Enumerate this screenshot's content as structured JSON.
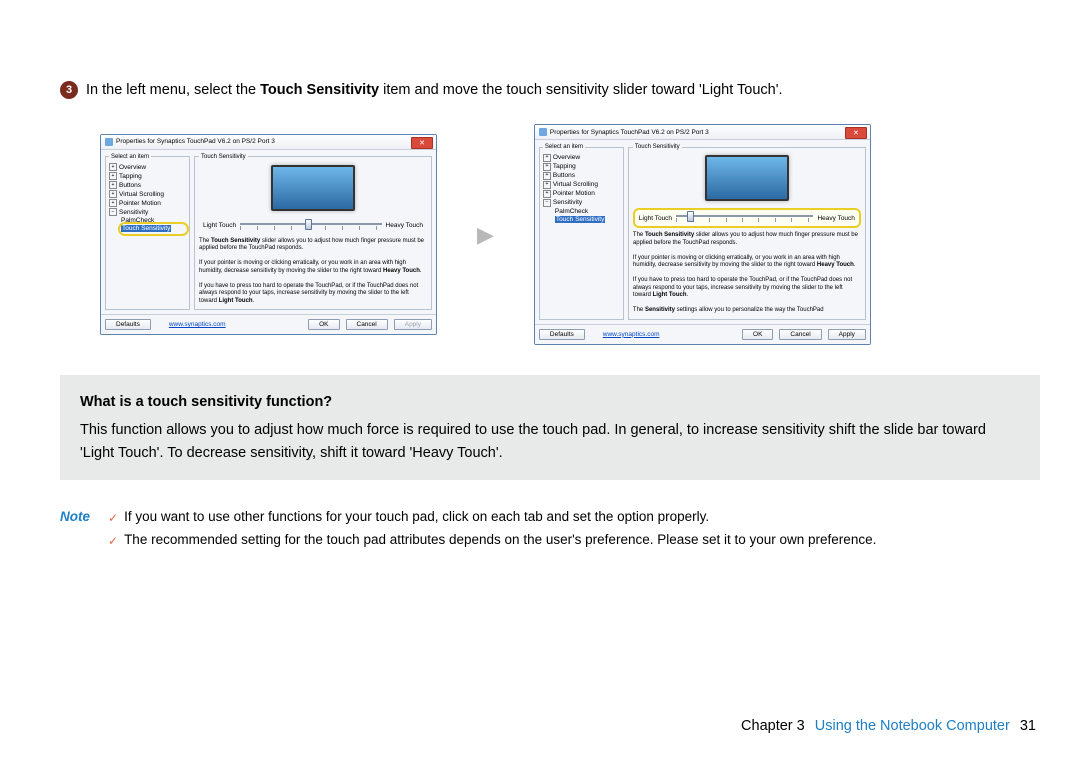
{
  "step": {
    "number": "3",
    "pre": "In the left menu, select the ",
    "bold": "Touch Sensitivity",
    "post": " item and move the touch sensitivity slider toward 'Light Touch'."
  },
  "window": {
    "title": "Properties for Synaptics TouchPad V6.2 on PS/2 Port 3",
    "select_legend": "Select an item",
    "tree": {
      "overview": "Overview",
      "tapping": "Tapping",
      "buttons": "Buttons",
      "vscroll": "Virtual Scrolling",
      "pointer": "Pointer Motion",
      "sensitivity": "Sensitivity",
      "palm": "PalmCheck",
      "touchsens": "Touch Sensitivity"
    },
    "panel_legend": "Touch Sensitivity",
    "slider": {
      "light": "Light Touch",
      "heavy": "Heavy Touch"
    },
    "desc": {
      "l1a": "The ",
      "l1b": "Touch Sensitivity",
      "l1c": " slider allows you to adjust how much finger pressure must be applied before the TouchPad responds.",
      "l2a": "If your pointer is moving or clicking erratically, or you work in an area with high humidity, decrease sensitivity by moving the slider to the right toward ",
      "l2b": "Heavy Touch",
      "l2c": ".",
      "l3a": "If you have to press too hard to operate the TouchPad, or if the TouchPad does not always respond to your taps, increase sensitivity by moving the slider to the left toward ",
      "l3b": "Light Touch",
      "l3c": ".",
      "l4a": "The ",
      "l4b": "Sensitivity",
      "l4c": " settings allow you to personalize the way the TouchPad"
    },
    "buttons": {
      "defaults": "Defaults",
      "link": "www.synaptics.com",
      "ok": "OK",
      "cancel": "Cancel",
      "apply": "Apply"
    }
  },
  "info": {
    "title": "What is a touch sensitivity function?",
    "body": "This function allows you to adjust how much force is required to use the touch pad. In general,  to increase sensitivity shift the slide bar toward 'Light Touch'. To decrease sensitivity, shift it toward 'Heavy Touch'."
  },
  "note": {
    "label": "Note",
    "n1": "If you want to use other functions for your touch pad, click on each tab and set the option properly.",
    "n2": "The recommended setting for the touch pad attributes depends on the user's preference. Please set it to your own preference."
  },
  "footer": {
    "chapter": "Chapter 3",
    "title": "Using the Notebook Computer",
    "page": "31"
  }
}
